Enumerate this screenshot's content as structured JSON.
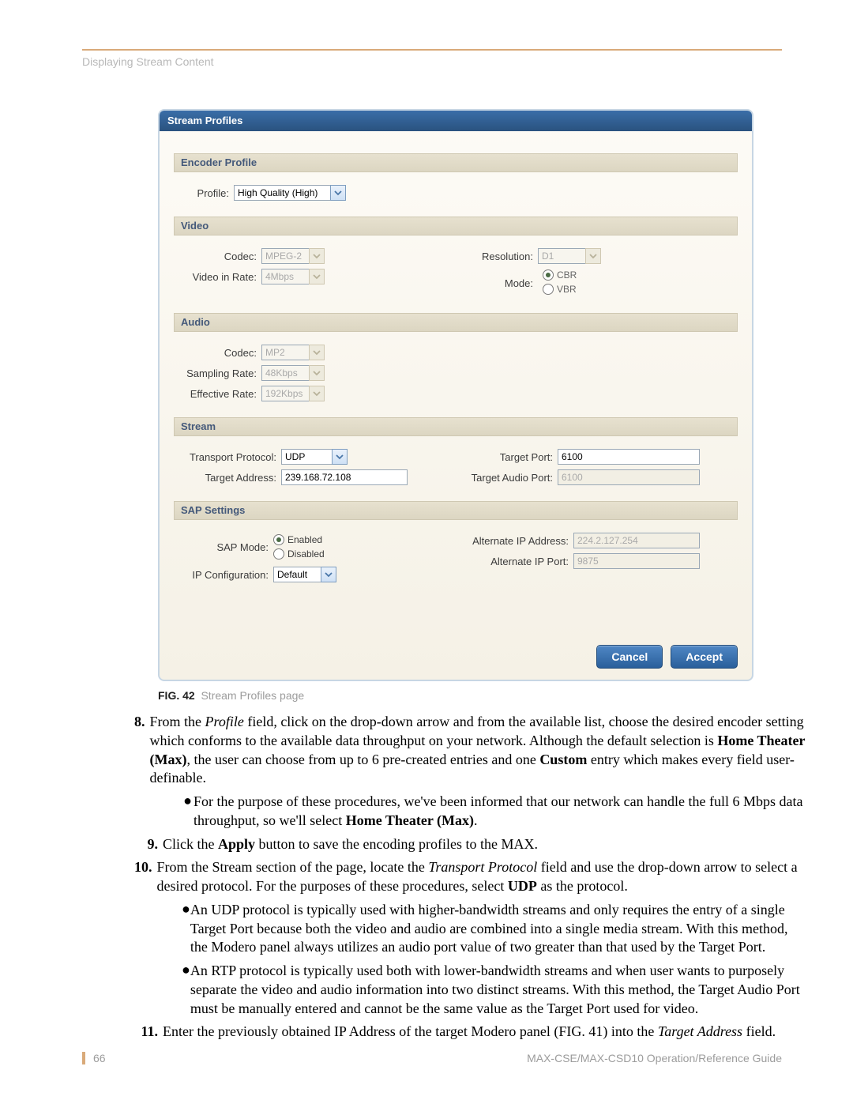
{
  "header": "Displaying Stream Content",
  "figure": {
    "title": "Stream Profiles",
    "caption_prefix": "FIG. 42",
    "caption_text": "Stream Profiles page",
    "encoder": {
      "heading": "Encoder Profile",
      "profile_label": "Profile:",
      "profile_value": "High Quality (High)"
    },
    "video": {
      "heading": "Video",
      "codec_label": "Codec:",
      "codec_value": "MPEG-2",
      "rate_label": "Video in Rate:",
      "rate_value": "4Mbps",
      "res_label": "Resolution:",
      "res_value": "D1",
      "mode_label": "Mode:",
      "mode_cbr": "CBR",
      "mode_vbr": "VBR"
    },
    "audio": {
      "heading": "Audio",
      "codec_label": "Codec:",
      "codec_value": "MP2",
      "sampling_label": "Sampling Rate:",
      "sampling_value": "48Kbps",
      "effective_label": "Effective Rate:",
      "effective_value": "192Kbps"
    },
    "stream": {
      "heading": "Stream",
      "proto_label": "Transport Protocol:",
      "proto_value": "UDP",
      "addr_label": "Target Address:",
      "addr_value": "239.168.72.108",
      "tport_label": "Target Port:",
      "tport_value": "6100",
      "taudio_label": "Target Audio Port:",
      "taudio_value": "6100"
    },
    "sap": {
      "heading": "SAP Settings",
      "mode_label": "SAP Mode:",
      "enabled": "Enabled",
      "disabled": "Disabled",
      "ipconf_label": "IP Configuration:",
      "ipconf_value": "Default",
      "altip_label": "Alternate IP Address:",
      "altip_value": "224.2.127.254",
      "altport_label": "Alternate IP Port:",
      "altport_value": "9875"
    },
    "buttons": {
      "cancel": "Cancel",
      "accept": "Accept"
    }
  },
  "steps": {
    "s8_num": "8.",
    "s8a": "From the ",
    "s8_profile": "Profile",
    "s8b": " field, click on the drop-down arrow and from the available list, choose the desired encoder setting which conforms to the available data throughput on your network. Although the default selection is ",
    "s8_ht": "Home Theater (Max)",
    "s8c": ", the user can choose from up to 6 pre-created entries and one ",
    "s8_custom": "Custom",
    "s8d": " entry which makes every field user-definable.",
    "s8_bul_a": "For the purpose of these procedures, we've been informed that our network can handle the full 6 Mbps data throughput, so we'll select ",
    "s8_bul_b": "Home Theater (Max)",
    "s8_bul_c": ".",
    "s9_num": "9.",
    "s9a": "Click the ",
    "s9_apply": "Apply",
    "s9b": " button to save the encoding profiles to the MAX.",
    "s10_num": "10.",
    "s10a": "From the Stream section of the page, locate the ",
    "s10_tp": "Transport Protocol",
    "s10b": " field and use the drop-down arrow to select a desired protocol. For the purposes of these procedures, select ",
    "s10_udp": "UDP",
    "s10c": " as the protocol.",
    "s10_bul1": "An UDP protocol is typically used with higher-bandwidth streams and only requires the entry of a single Target Port because both the video and audio are combined into a single media stream. With this method, the Modero panel always utilizes an audio port value of two greater than that used by the Target Port.",
    "s10_bul2": "An RTP protocol is typically used both with lower-bandwidth streams and when user wants to purposely separate the video and audio information into two distinct streams. With this method, the Target Audio Port must be manually entered and cannot be the same value as the Target Port used for video.",
    "s11_num": "11.",
    "s11a": "Enter the previously obtained IP Address of the target Modero panel (FIG. 41) into the ",
    "s11_ta": "Target Address",
    "s11b": " field."
  },
  "footer": {
    "page": "66",
    "guide": "MAX-CSE/MAX-CSD10 Operation/Reference Guide"
  }
}
